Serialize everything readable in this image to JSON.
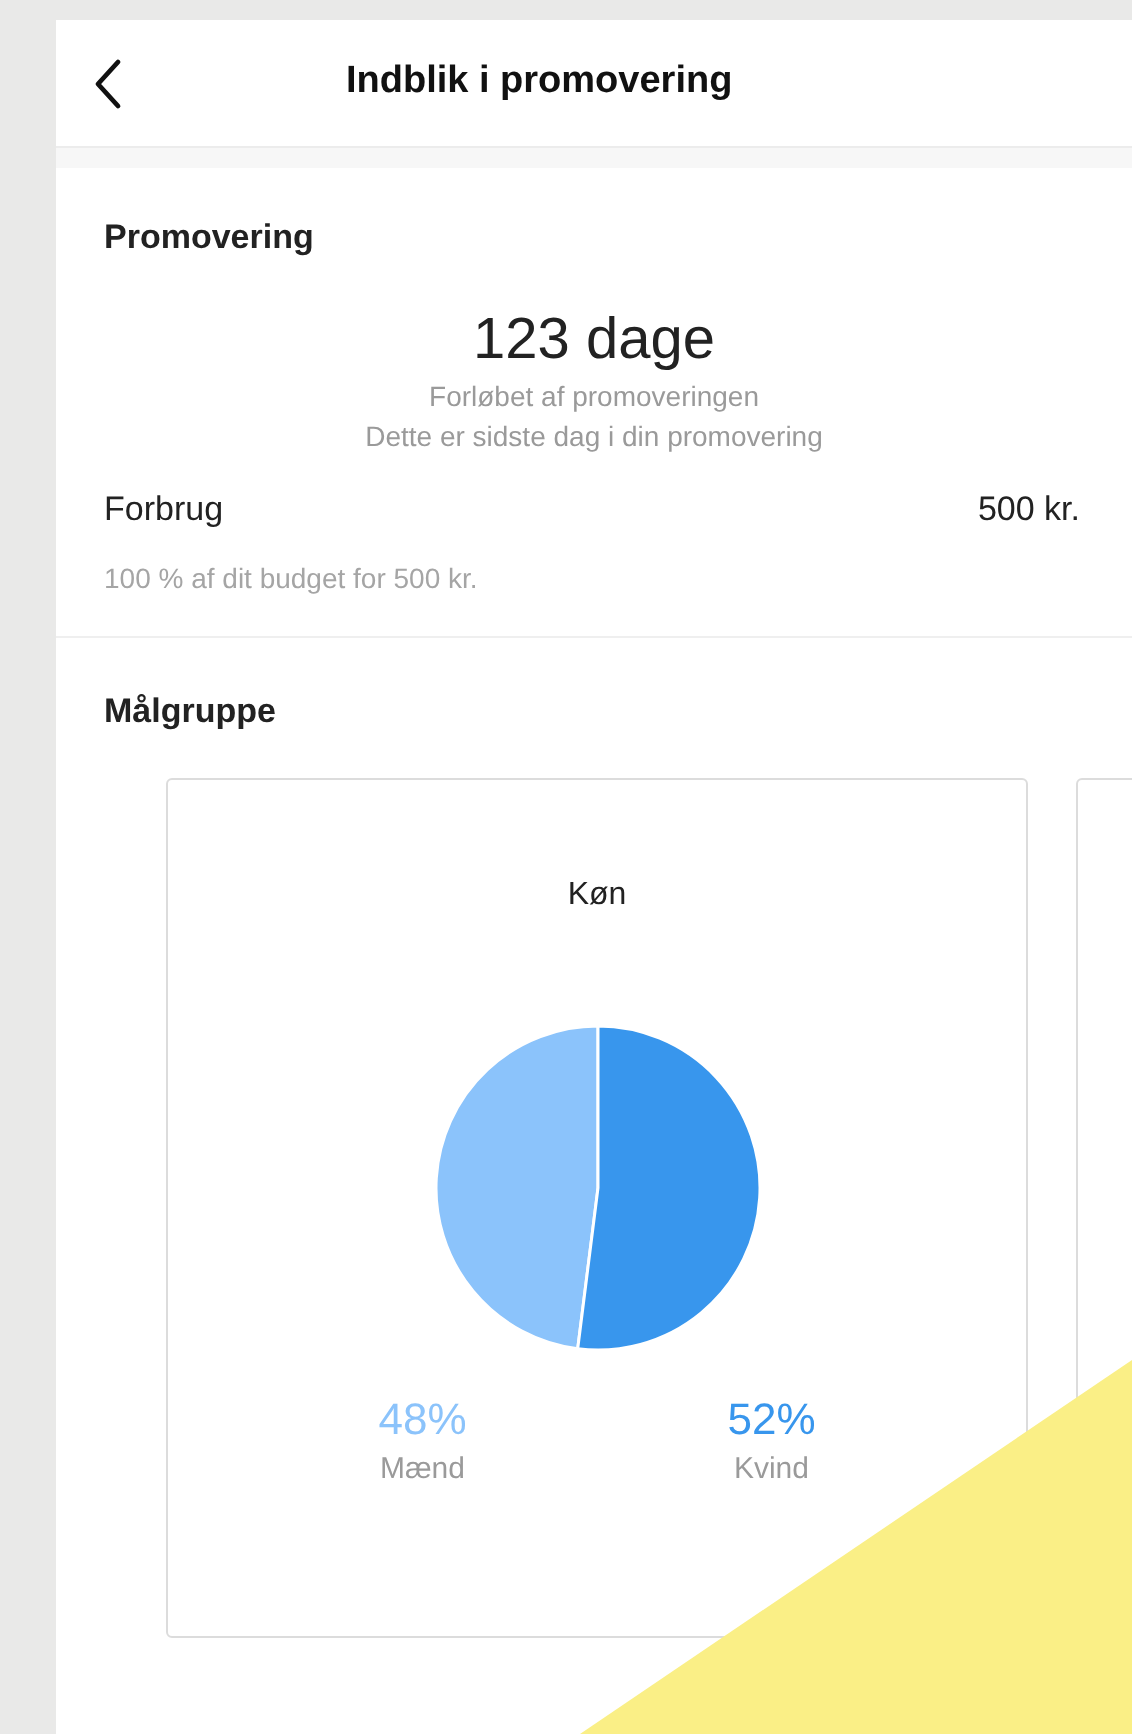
{
  "header": {
    "title": "Indblik i promovering"
  },
  "promotion": {
    "heading": "Promovering",
    "duration": "123 dage",
    "caption": "Forløbet af promoveringen",
    "note": "Dette er sidste dag i din promovering",
    "spend_label": "Forbrug",
    "spend_value": "500 kr.",
    "budget_note": "100 % af dit budget for 500 kr."
  },
  "audience": {
    "heading": "Målgruppe",
    "gender_card": {
      "title": "Køn",
      "legend": [
        {
          "value": "48%",
          "label": "Mænd",
          "color": "#8bc3fb"
        },
        {
          "value": "52%",
          "label": "Kvind",
          "color": "#3896ed"
        }
      ],
      "chart_data": {
        "type": "pie",
        "values": [
          48,
          52
        ]
      }
    }
  }
}
